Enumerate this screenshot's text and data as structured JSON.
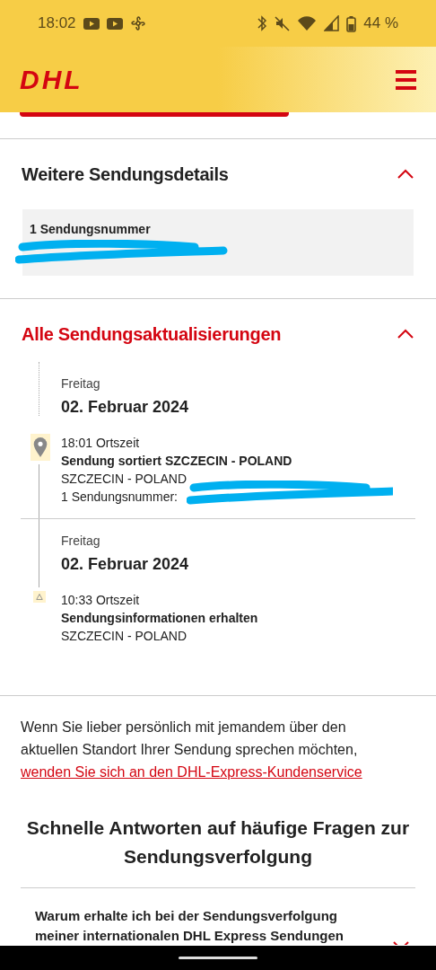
{
  "status_bar": {
    "time": "18:02",
    "battery": "44 %"
  },
  "header": {
    "logo": "DHL"
  },
  "details": {
    "title": "Weitere Sendungsdetails",
    "expanded": true,
    "active": false,
    "label": "1 Sendungsnummer",
    "number_redacted": true
  },
  "updates": {
    "title": "Alle Sendungsaktualisierungen",
    "expanded": true,
    "active": true,
    "events": [
      {
        "kind": "pin",
        "day": "Freitag",
        "date": "02. Februar 2024",
        "time": "18:01 Ortszeit",
        "title": "Sendung sortiert SZCZECIN - POLAND",
        "location": "SZCZECIN - POLAND",
        "reference": "1 Sendungsnummer:",
        "number_redacted": true
      },
      {
        "kind": "start",
        "day": "Freitag",
        "date": "02. Februar 2024",
        "time": "10:33 Ortszeit",
        "title": "Sendungsinformationen erhalten",
        "location": "SZCZECIN - POLAND"
      }
    ]
  },
  "contact": {
    "text": "Wenn Sie lieber persönlich mit jemandem über den aktuellen Standort Ihrer Sendung sprechen möchten,",
    "link": "wenden Sie sich an den DHL-Express-Kundenservice"
  },
  "faq": {
    "heading": "Schnelle Antworten auf häufige Fragen zur Sendungsverfolgung",
    "items": [
      {
        "question": "Warum erhalte ich bei der Sendungsverfolgung meiner internationalen DHL Express Sendungen",
        "expanded": false
      }
    ]
  }
}
